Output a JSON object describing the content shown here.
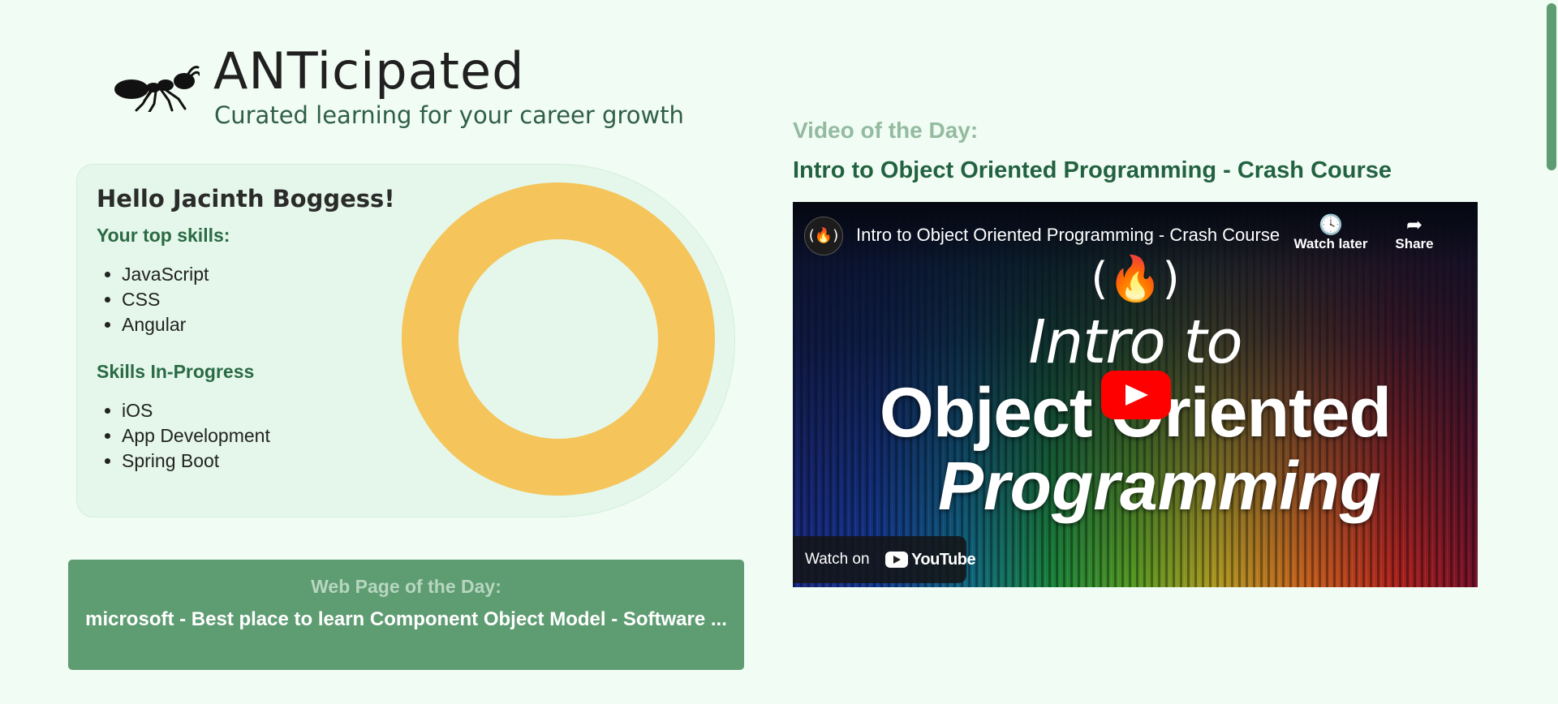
{
  "header": {
    "app_name": "ANTicipated",
    "tagline": "Curated learning for your career growth",
    "logo_icon": "ant-icon"
  },
  "profile": {
    "greeting": "Hello Jacinth Boggess!",
    "top_skills_heading": "Your top skills:",
    "top_skills": [
      "JavaScript",
      "CSS",
      "Angular"
    ],
    "in_progress_heading": "Skills In-Progress",
    "in_progress_skills": [
      "iOS",
      "App Development",
      "Spring Boot"
    ],
    "progress_ring_color": "#f5c45a"
  },
  "web_page_of_day": {
    "label": "Web Page of the Day:",
    "title": "microsoft - Best place to learn Component Object Model - Software ..."
  },
  "video_of_day": {
    "label": "Video of the Day:",
    "title": "Intro to Object Oriented Programming - Crash Course",
    "player": {
      "channel_logo": "(🔥)",
      "video_title": "Intro to Object Oriented Programming - Crash Course",
      "watch_later": "Watch later",
      "share": "Share",
      "thumb_logo": "(🔥)",
      "thumb_line1": "Intro to",
      "thumb_line2": "Object Oriented",
      "thumb_line3": "Programming",
      "watch_on": "Watch on",
      "youtube": "YouTube"
    }
  },
  "colors": {
    "background": "#f1fcf4",
    "card": "#e4f7ea",
    "accent_green": "#5e9c72",
    "heading_green": "#236240",
    "youtube_red": "#ff0000"
  }
}
